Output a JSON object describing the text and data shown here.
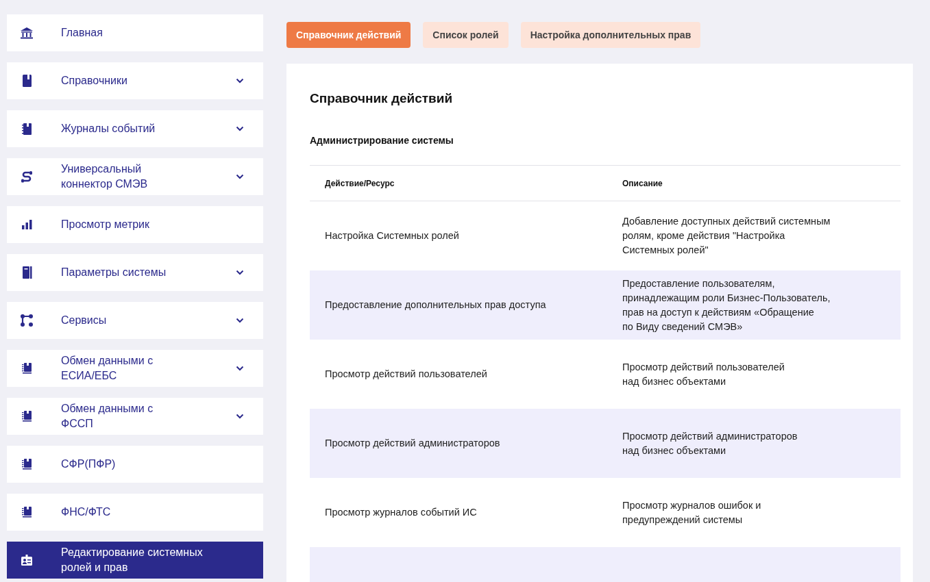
{
  "sidebar": {
    "items": [
      {
        "label": "Главная",
        "kind": "bank",
        "expandable": false,
        "selected": false
      },
      {
        "label": "Справочники",
        "kind": "book",
        "expandable": true,
        "selected": false
      },
      {
        "label": "Журналы событий",
        "kind": "notebook",
        "expandable": true,
        "selected": false
      },
      {
        "label": "Универсальный\nконнектор СМЭВ",
        "kind": "connector",
        "expandable": true,
        "selected": false
      },
      {
        "label": "Просмотр метрик",
        "kind": "bars",
        "expandable": false,
        "selected": false
      },
      {
        "label": "Параметры системы",
        "kind": "panel",
        "expandable": true,
        "selected": false
      },
      {
        "label": "Сервисы",
        "kind": "nodes",
        "expandable": true,
        "selected": false
      },
      {
        "label": "Обмен данными с\nЕСИА/ЕБС",
        "kind": "notebooks",
        "expandable": true,
        "selected": false
      },
      {
        "label": "Обмен данными с\nФССП",
        "kind": "notebooks",
        "expandable": true,
        "selected": false
      },
      {
        "label": "СФР(ПФР)",
        "kind": "notebooks",
        "expandable": false,
        "selected": false
      },
      {
        "label": "ФНС/ФТС",
        "kind": "notebooks",
        "expandable": false,
        "selected": false
      },
      {
        "label": "Редактирование системных\nролей и прав",
        "kind": "badge",
        "expandable": false,
        "selected": true
      }
    ]
  },
  "tabs": [
    {
      "label": "Справочник действий",
      "selected": true
    },
    {
      "label": "Список ролей",
      "selected": false
    },
    {
      "label": "Настройка дополнительных прав",
      "selected": false
    }
  ],
  "panel": {
    "title": "Справочник действий",
    "section": "Администрирование системы",
    "table": {
      "columns": [
        "Действие/Ресурс",
        "Описание"
      ],
      "rows": [
        {
          "action": "Настройка Системных ролей",
          "description": "Добавление доступных действий системным\nролям, кроме действия \"Настройка\nСистемных ролей\""
        },
        {
          "action": "Предоставление дополнительных прав доступа",
          "description": "Предоставление пользователям,\nпринадлежащим роли Бизнес-Пользователь,\nправ на доступ к действиям «Обращение\nпо Виду сведений СМЭВ»"
        },
        {
          "action": "Просмотр действий пользователей",
          "description": "Просмотр действий пользователей\nнад бизнес объектами"
        },
        {
          "action": "Просмотр действий администраторов",
          "description": "Просмотр действий администраторов\nнад бизнес объектами"
        },
        {
          "action": "Просмотр журналов событий ИС",
          "description": "Просмотр журналов ошибок и\nпредупреждений системы"
        }
      ]
    }
  }
}
